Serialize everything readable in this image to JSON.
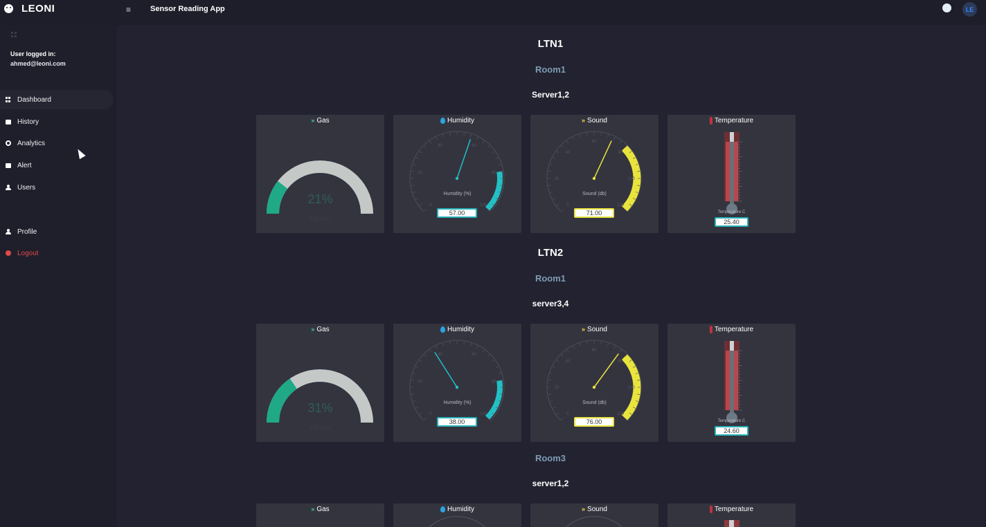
{
  "topbar": {
    "brand": "LEONI",
    "app_title": "Sensor Reading App",
    "avatar_initials": "LE",
    "menu_icon": "hamburger-icon"
  },
  "sidebar": {
    "user_label": "User logged in:",
    "user_email": "ahmed@leoni.com",
    "items": [
      {
        "label": "Dashboard",
        "icon": "dashboard-icon",
        "active": true
      },
      {
        "label": "History",
        "icon": "history-icon"
      },
      {
        "label": "Analytics",
        "icon": "analytics-icon"
      },
      {
        "label": "Alert",
        "icon": "alert-icon"
      },
      {
        "label": "Users",
        "icon": "users-icon"
      },
      {
        "label": "Profile",
        "icon": "profile-icon"
      },
      {
        "label": "Logout",
        "icon": "logout-icon",
        "color": "#e0494a"
      }
    ]
  },
  "colors": {
    "gas": "#1fa987",
    "humidity": "#21c0c6",
    "sound": "#e9e43c",
    "temperature": "#c2343a"
  },
  "main": {
    "sections": [
      {
        "site": "LTN1",
        "room": "Room1",
        "server": "Server1,2",
        "cards": {
          "gas_title": "Gas",
          "gas_percent": 21,
          "gas_percent_text": "21%",
          "gas_ppm": "630 ppm",
          "humidity_title": "Humidity",
          "humidity_label": "Humidity (%)",
          "humidity_value": 57,
          "humidity_text": "57.00",
          "sound_title": "Sound",
          "sound_label": "Sound (db)",
          "sound_value": 71,
          "sound_text": "71.00",
          "temperature_title": "Temperature",
          "temperature_label": "Temperature C",
          "temperature_value": 25.4,
          "temperature_text": "25.40"
        }
      },
      {
        "site": "LTN2",
        "room": "Room1",
        "server": "server3,4",
        "cards": {
          "gas_title": "Gas",
          "gas_percent": 31,
          "gas_percent_text": "31%",
          "gas_ppm": "930 ppm",
          "humidity_title": "Humidity",
          "humidity_label": "Humidity (%)",
          "humidity_value": 38,
          "humidity_text": "38.00",
          "sound_title": "Sound",
          "sound_label": "Sound (db)",
          "sound_value": 76,
          "sound_text": "76.00",
          "temperature_title": "Temperature",
          "temperature_label": "Temperature C",
          "temperature_value": 24.6,
          "temperature_text": "24.60"
        }
      },
      {
        "room": "Room3",
        "server": "server1,2",
        "cards": {
          "gas_title": "Gas",
          "humidity_title": "Humidity",
          "sound_title": "Sound",
          "temperature_title": "Temperature"
        }
      }
    ],
    "gauge_ticks": [
      "0",
      "20",
      "40",
      "60",
      "80",
      "100"
    ],
    "sound_ticks": [
      "0",
      "20",
      "40",
      "60",
      "80",
      "100",
      "120"
    ]
  }
}
